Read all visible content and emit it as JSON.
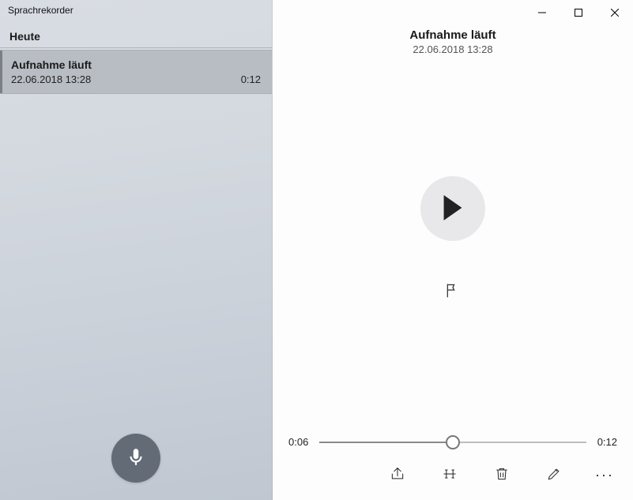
{
  "app": {
    "title": "Sprachrekorder"
  },
  "sidebar": {
    "section_label": "Heute",
    "items": [
      {
        "title": "Aufnahme läuft",
        "datetime": "22.06.2018 13:28",
        "duration": "0:12"
      }
    ]
  },
  "detail": {
    "title": "Aufnahme läuft",
    "datetime": "22.06.2018 13:28"
  },
  "playback": {
    "position_label": "0:06",
    "total_label": "0:12",
    "progress_percent": 50
  },
  "icons": {
    "record": "microphone-icon",
    "play": "play-icon",
    "flag": "flag-icon",
    "share": "share-icon",
    "trim": "trim-icon",
    "delete": "delete-icon",
    "rename": "edit-icon",
    "more": "more-icon"
  }
}
